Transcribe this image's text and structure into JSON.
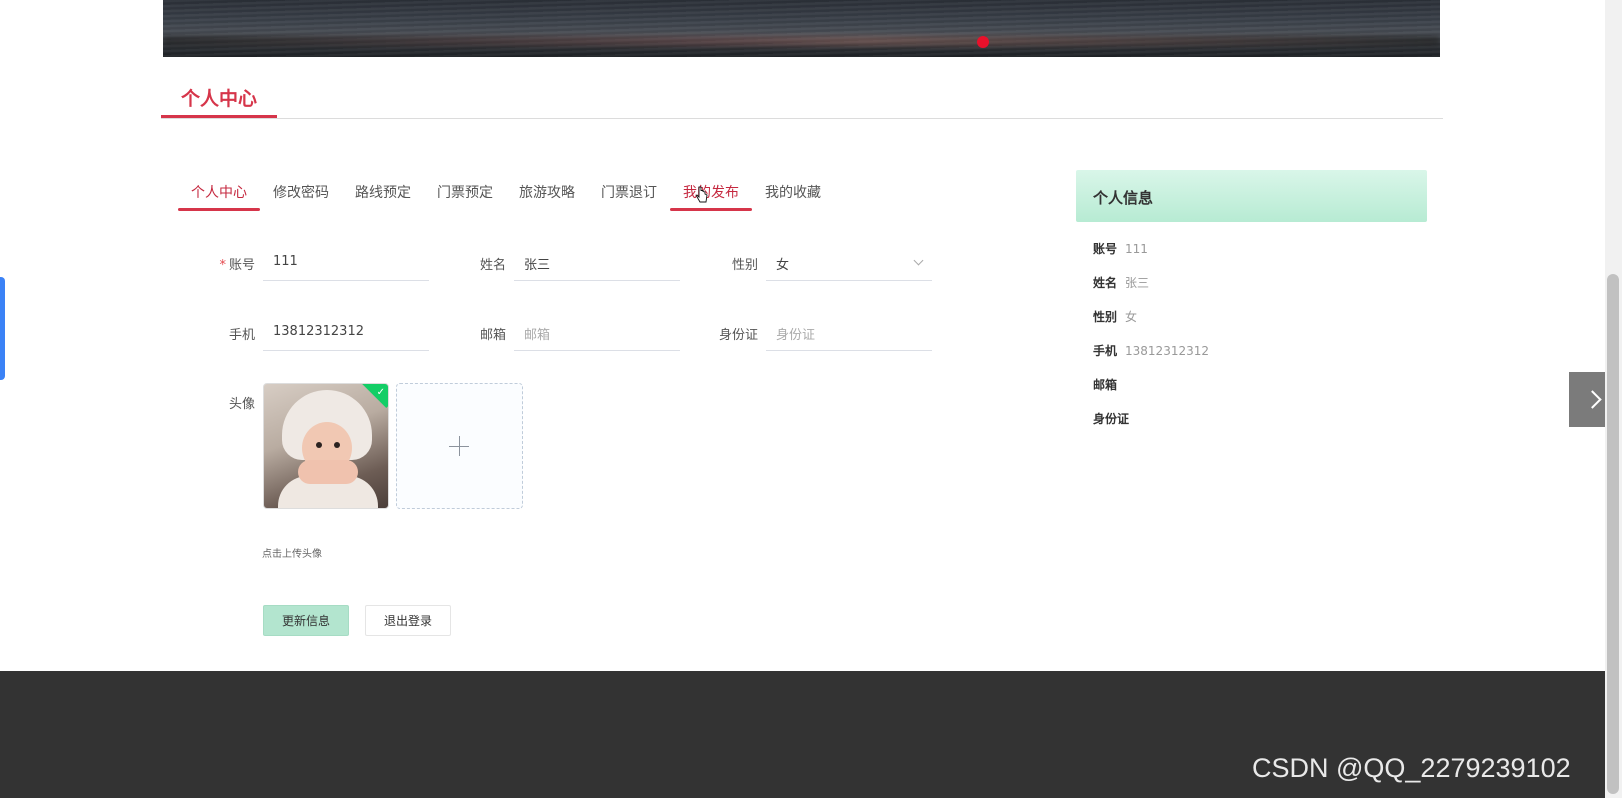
{
  "section": {
    "title": "个人中心"
  },
  "tabs": [
    {
      "label": "个人中心",
      "active": true
    },
    {
      "label": "修改密码",
      "active": false
    },
    {
      "label": "路线预定",
      "active": false
    },
    {
      "label": "门票预定",
      "active": false
    },
    {
      "label": "旅游攻略",
      "active": false
    },
    {
      "label": "门票退订",
      "active": false
    },
    {
      "label": "我的发布",
      "active": true
    },
    {
      "label": "我的收藏",
      "active": false
    }
  ],
  "form": {
    "account": {
      "label": "账号",
      "required_mark": "*",
      "value": "111"
    },
    "name": {
      "label": "姓名",
      "value": "张三"
    },
    "gender": {
      "label": "性别",
      "value": "女"
    },
    "phone": {
      "label": "手机",
      "value": "13812312312"
    },
    "email": {
      "label": "邮箱",
      "placeholder": "邮箱"
    },
    "idcard": {
      "label": "身份证",
      "placeholder": "身份证"
    },
    "avatar": {
      "label": "头像",
      "hint": "点击上传头像"
    },
    "update_button": "更新信息",
    "logout_button": "退出登录"
  },
  "profile_card": {
    "title": "个人信息",
    "rows": [
      {
        "key": "账号",
        "value": "111"
      },
      {
        "key": "姓名",
        "value": "张三"
      },
      {
        "key": "性别",
        "value": "女"
      },
      {
        "key": "手机",
        "value": "13812312312"
      },
      {
        "key": "邮箱",
        "value": ""
      },
      {
        "key": "身份证",
        "value": ""
      }
    ]
  },
  "watermark": "CSDN @QQ_2279239102",
  "colors": {
    "accent": "#d6354a",
    "card_green": "#b7ebd3",
    "footer": "#333333"
  }
}
